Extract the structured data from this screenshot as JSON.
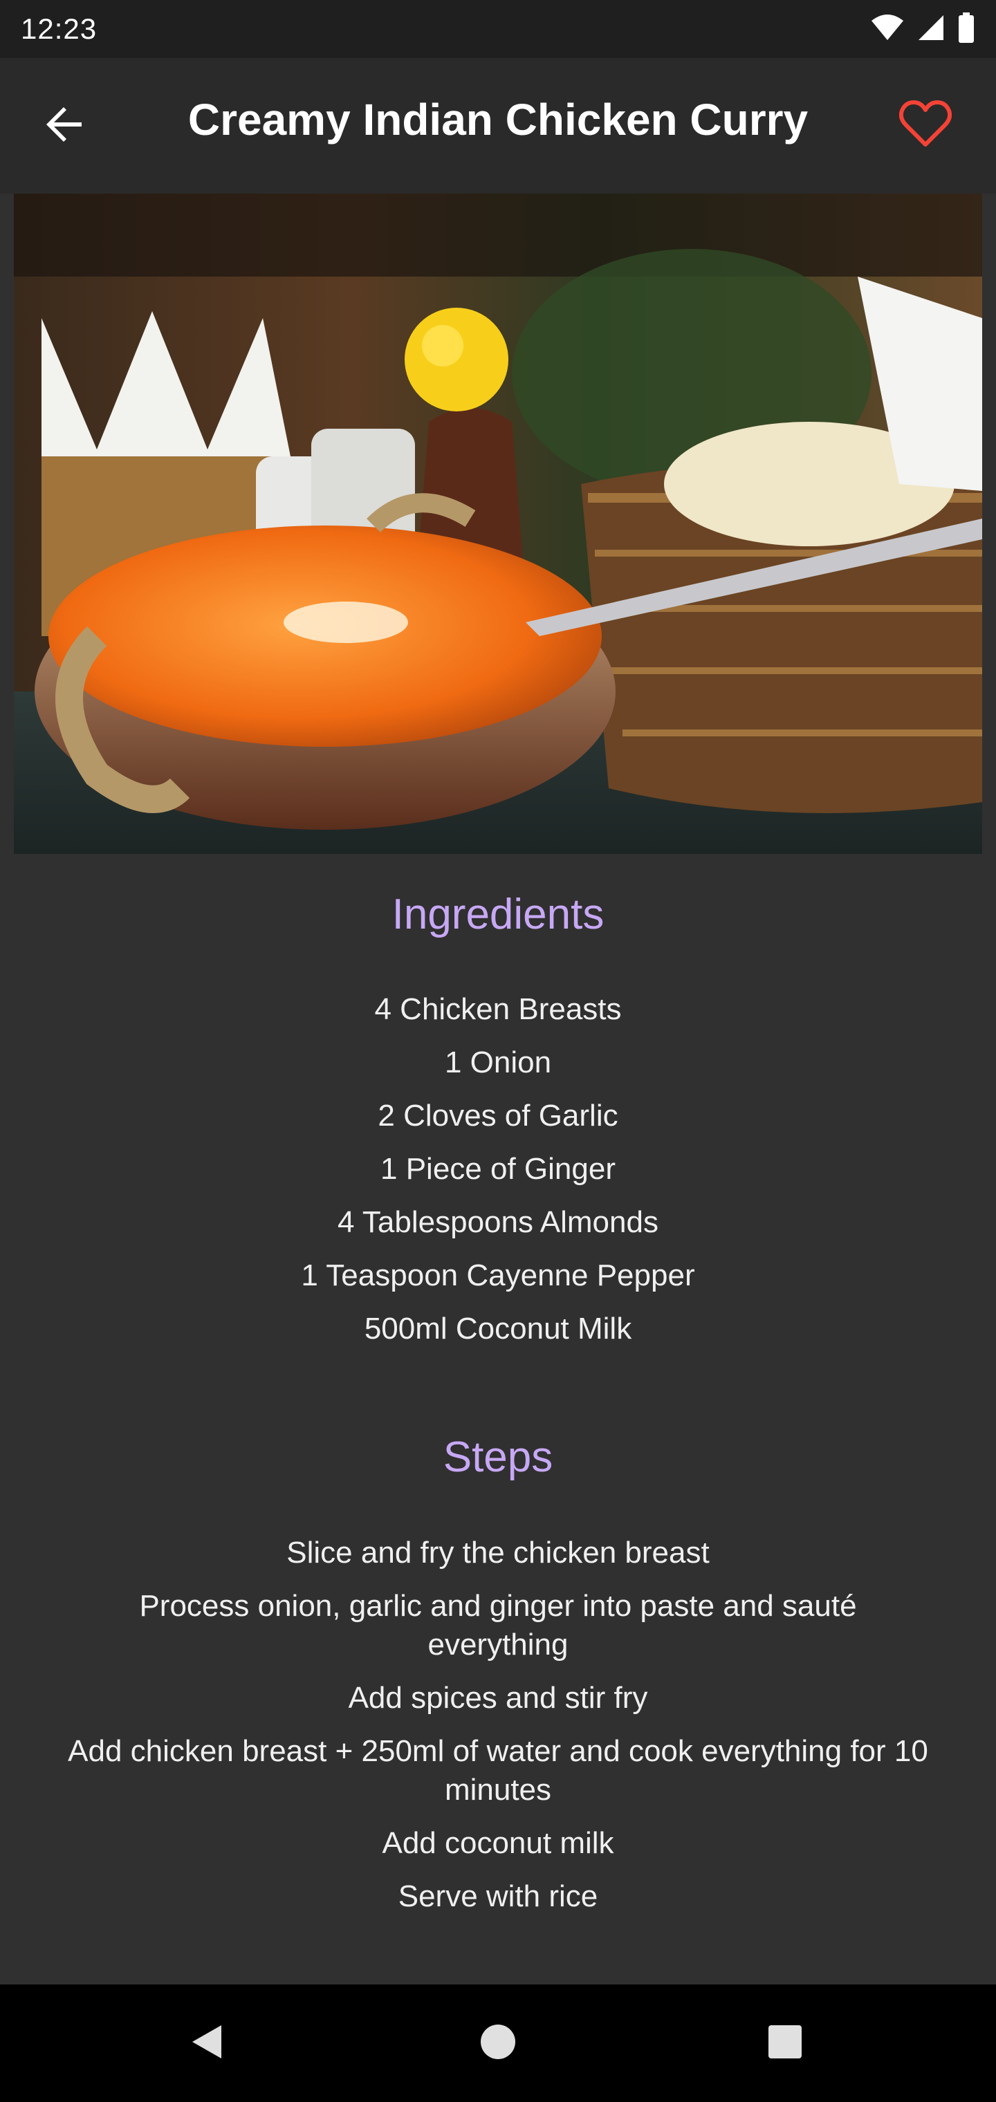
{
  "status_bar": {
    "time": "12:23",
    "icons": [
      "wifi-icon",
      "cell-signal-icon",
      "battery-icon"
    ]
  },
  "app_bar": {
    "title": "Creamy Indian Chicken Curry",
    "back_icon": "arrow-back-icon",
    "favorite_icon": "heart-outline-icon",
    "favorite_color": "#f44336"
  },
  "hero_image": {
    "subject": "bowl of orange chicken curry with naan bread basket"
  },
  "ingredients": {
    "heading": "Ingredients",
    "items": [
      "4 Chicken Breasts",
      "1 Onion",
      "2 Cloves of Garlic",
      "1 Piece of Ginger",
      "4 Tablespoons Almonds",
      "1 Teaspoon Cayenne Pepper",
      "500ml Coconut Milk"
    ]
  },
  "steps": {
    "heading": "Steps",
    "items": [
      "Slice and fry the chicken breast",
      "Process onion, garlic and ginger into paste and sauté everything",
      "Add spices and stir fry",
      "Add chicken breast + 250ml of water and cook everything for 10 minutes",
      "Add coconut milk",
      "Serve with rice"
    ]
  },
  "navigation_bar": {
    "icons": [
      "nav-back-icon",
      "nav-home-icon",
      "nav-recents-icon"
    ]
  },
  "colors": {
    "accent": "#c7a8f5",
    "background": "#303030",
    "app_bar": "#2a2a2a"
  }
}
